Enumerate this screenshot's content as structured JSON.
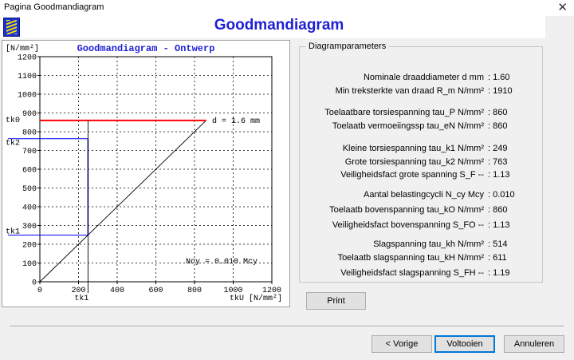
{
  "window": {
    "title": "Pagina Goodmandiagram",
    "close_glyph": "✕"
  },
  "header": {
    "title": "Goodmandiagram",
    "logo_icon": "spring-icon"
  },
  "chart_data": {
    "type": "line",
    "title": "Goodmandiagram - Ontwerp",
    "ylabel": "[N/mm²]",
    "xlabel": "tkU [N/mm²]",
    "xlim": [
      0,
      1200
    ],
    "ylim": [
      0,
      1200
    ],
    "xticks": [
      0,
      200,
      400,
      600,
      800,
      1000,
      1200
    ],
    "yticks": [
      0,
      100,
      200,
      300,
      400,
      500,
      600,
      700,
      800,
      900,
      1000,
      1100,
      1200
    ],
    "grid": true,
    "diagonal": {
      "x": [
        0,
        860
      ],
      "y": [
        0,
        860
      ]
    },
    "tk0_line": {
      "value": 860,
      "color": "#ff0000",
      "label": "tk0"
    },
    "tk2_line": {
      "value": 763,
      "color": "#0000ff",
      "label": "tk2"
    },
    "tk1_line": {
      "value": 249,
      "color": "#0000ff",
      "label": "tk1"
    },
    "tk1_vertical": {
      "x": 249,
      "label": "tk1"
    },
    "annotations": {
      "diameter": "d = 1.6  mm",
      "cycles": "Ncy = 0.010  Mcy"
    }
  },
  "params": {
    "legend": "Diagramparameters",
    "rows": [
      {
        "label": "Nominale draaddiameter   d       mm",
        "value": ": 1.60",
        "top": 32
      },
      {
        "label": "Min treksterkte van draad   R_m  N/mm²",
        "value": ": 1910",
        "top": 49
      },
      {
        "label": "Toelaatbare torsiespanning   tau_P  N/mm²",
        "value": ": 860",
        "top": 76
      },
      {
        "label": "Toelaatb vermoeiingssp  tau_eN  N/mm²",
        "value": ": 860",
        "top": 93
      },
      {
        "label": "Kleine torsiespanning   tau_k1   N/mm²",
        "value": ": 249",
        "top": 121
      },
      {
        "label": "Grote torsiespanning   tau_k2   N/mm²",
        "value": ": 763",
        "top": 138
      },
      {
        "label": "Veiligheidsfact grote spanning  S_F     --",
        "value": ": 1.13",
        "top": 154
      },
      {
        "label": "Aantal belastingcycli   N_cy     Mcy",
        "value": ": 0.010",
        "top": 179
      },
      {
        "label": "Toelaatb bovenspanning  tau_kO  N/mm²",
        "value": ": 860",
        "top": 198
      },
      {
        "label": "Veiligheidsfact bovenspanning  S_FO   --",
        "value": ": 1.13",
        "top": 217
      },
      {
        "label": "Slagspanning   tau_kh   N/mm²",
        "value": ": 514",
        "top": 241
      },
      {
        "label": "Toelaatb slagspanning   tau_kH   N/mm²",
        "value": ": 611",
        "top": 258
      },
      {
        "label": "Veiligheidsfact slagspanning  S_FH     --",
        "value": ": 1.19",
        "top": 277
      }
    ]
  },
  "buttons": {
    "print": "Print",
    "back": "< Vorige",
    "finish": "Voltooien",
    "cancel": "Annuleren"
  }
}
